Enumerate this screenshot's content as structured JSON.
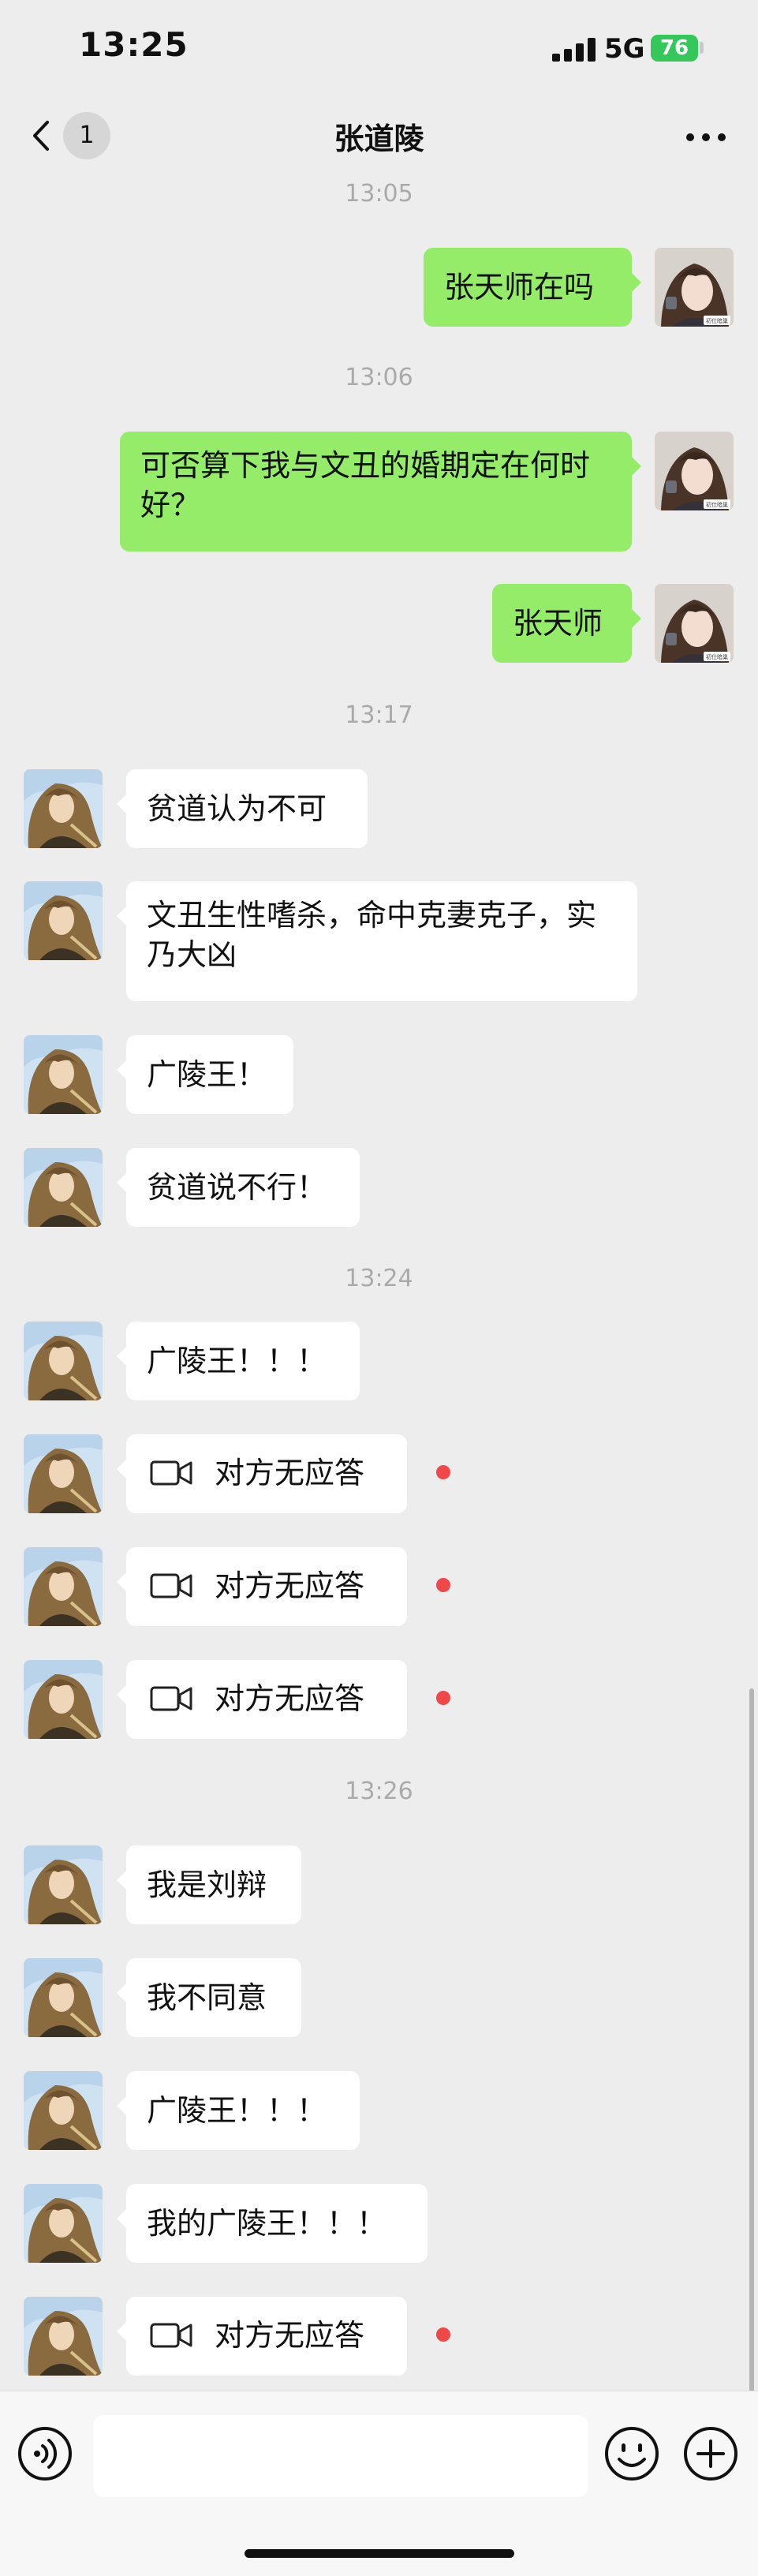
{
  "status_bar": {
    "time": "13:25",
    "network": "5G",
    "battery": "76"
  },
  "nav": {
    "unread_count": "1",
    "title": "张道陵"
  },
  "timestamps": [
    "13:05",
    "13:06",
    "13:17",
    "13:24",
    "13:26"
  ],
  "messages": [
    {
      "side": "out",
      "type": "text",
      "text": "张天师在吗"
    },
    {
      "side": "out",
      "type": "text",
      "text": "可否算下我与文丑的婚期定在何时好？"
    },
    {
      "side": "out",
      "type": "text",
      "text": "张天师"
    },
    {
      "side": "in",
      "type": "text",
      "text": "贫道认为不可"
    },
    {
      "side": "in",
      "type": "text",
      "text": "文丑生性嗜杀，命中克妻克子，实乃大凶"
    },
    {
      "side": "in",
      "type": "text",
      "text": "广陵王！"
    },
    {
      "side": "in",
      "type": "text",
      "text": "贫道说不行！"
    },
    {
      "side": "in",
      "type": "text",
      "text": "广陵王！！！"
    },
    {
      "side": "in",
      "type": "video_call",
      "text": "对方无应答",
      "missed": true
    },
    {
      "side": "in",
      "type": "video_call",
      "text": "对方无应答",
      "missed": true
    },
    {
      "side": "in",
      "type": "video_call",
      "text": "对方无应答",
      "missed": true
    },
    {
      "side": "in",
      "type": "text",
      "text": "我是刘辩"
    },
    {
      "side": "in",
      "type": "text",
      "text": "我不同意"
    },
    {
      "side": "in",
      "type": "text",
      "text": "广陵王！！！"
    },
    {
      "side": "in",
      "type": "text",
      "text": "我的广陵王！！！"
    },
    {
      "side": "in",
      "type": "video_call",
      "text": "对方无应答",
      "missed": true
    }
  ],
  "avatars": {
    "self_badge_text": "初仕暗巢",
    "self_icon": "portrait-self-icon",
    "contact_icon": "portrait-contact-icon"
  },
  "input_bar": {
    "message_value": "",
    "voice_icon": "voice-icon",
    "emoji_icon": "emoji-icon",
    "more_icon": "plus-icon"
  },
  "colors": {
    "background": "#ededed",
    "outgoing_bubble": "#95ec69",
    "incoming_bubble": "#ffffff",
    "missed_dot": "#f04848",
    "battery": "#34c759",
    "timestamp": "#aaaaaa"
  }
}
